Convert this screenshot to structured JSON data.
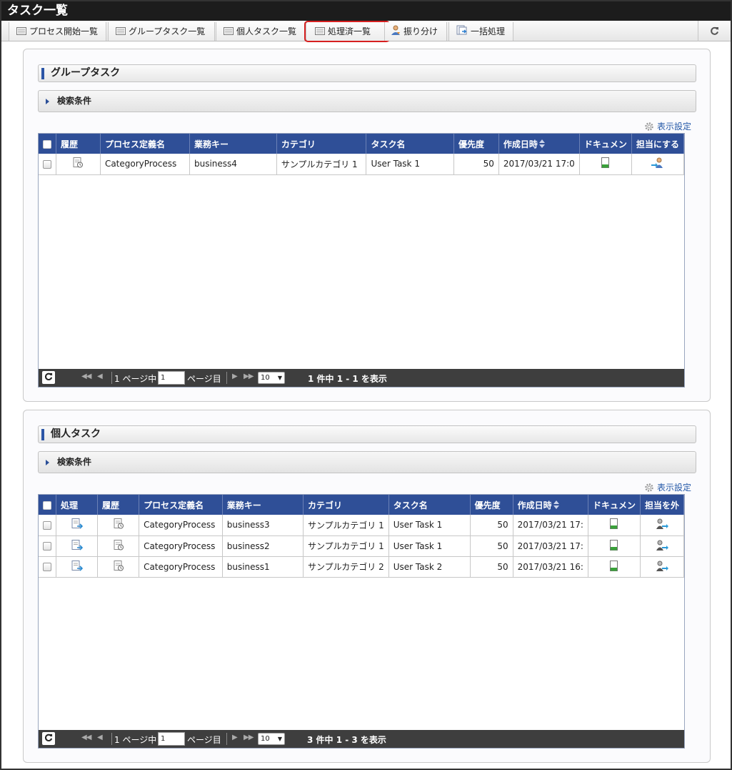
{
  "window": {
    "title": "タスク一覧"
  },
  "tabs": [
    {
      "label": "プロセス開始一覧",
      "icon": "list-icon"
    },
    {
      "label": "グループタスク一覧",
      "icon": "list-icon"
    },
    {
      "label": "個人タスク一覧",
      "icon": "list-icon"
    },
    {
      "label": "処理済一覧",
      "icon": "list-icon",
      "highlighted": true
    },
    {
      "label": "振り分け",
      "icon": "user-assign-icon"
    },
    {
      "label": "一括処理",
      "icon": "batch-process-icon"
    }
  ],
  "colors": {
    "header_blue": "#2f4f97",
    "highlight_red": "#d62020",
    "pager_dark": "#3e3e3e",
    "link_blue": "#2458a8"
  },
  "group_task": {
    "title": "グループタスク",
    "search_label": "検索条件",
    "display_setting": "表示設定",
    "columns": [
      "履歴",
      "プロセス定義名",
      "業務キー",
      "カテゴリ",
      "タスク名",
      "優先度",
      "作成日時",
      "ドキュメン",
      "担当にする"
    ],
    "rows": [
      {
        "process": "CategoryProcess",
        "business_key": "business4",
        "category": "サンプルカテゴリ 1",
        "task": "User Task 1",
        "priority": "50",
        "created": "2017/03/21 17:0"
      }
    ],
    "pager": {
      "page_prefix": "1 ページ中",
      "page_value": "1",
      "page_suffix": "ページ目",
      "rows_per_page": "10",
      "summary": "1 件中 1 - 1 を表示"
    }
  },
  "personal_task": {
    "title": "個人タスク",
    "search_label": "検索条件",
    "display_setting": "表示設定",
    "columns": [
      "処理",
      "履歴",
      "プロセス定義名",
      "業務キー",
      "カテゴリ",
      "タスク名",
      "優先度",
      "作成日時",
      "ドキュメン",
      "担当を外"
    ],
    "rows": [
      {
        "process": "CategoryProcess",
        "business_key": "business3",
        "category": "サンプルカテゴリ 1",
        "task": "User Task 1",
        "priority": "50",
        "created": "2017/03/21 17:"
      },
      {
        "process": "CategoryProcess",
        "business_key": "business2",
        "category": "サンプルカテゴリ 1",
        "task": "User Task 1",
        "priority": "50",
        "created": "2017/03/21 17:"
      },
      {
        "process": "CategoryProcess",
        "business_key": "business1",
        "category": "サンプルカテゴリ 2",
        "task": "User Task 2",
        "priority": "50",
        "created": "2017/03/21 16:"
      }
    ],
    "pager": {
      "page_prefix": "1 ページ中",
      "page_value": "1",
      "page_suffix": "ページ目",
      "rows_per_page": "10",
      "summary": "3 件中 1 - 3 を表示"
    }
  }
}
